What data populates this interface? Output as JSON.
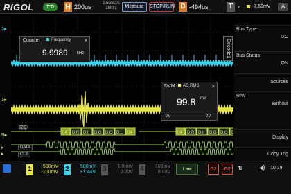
{
  "app": {
    "brand": "RIGOL",
    "mode": "T'D"
  },
  "topbar": {
    "h_label": "H",
    "timebase": "200us",
    "sample_rate": "2.5GSa/s",
    "mem_depth": "1Mpts",
    "measure": "Measure",
    "stop_run": "STOP/RUN",
    "d_label": "D",
    "delay": "-494us",
    "t_label": "T",
    "trigger_level": "-7.59mV",
    "trigger_source": "A"
  },
  "counter": {
    "title": "Counter",
    "tag": "Frequency",
    "value": "9.9989",
    "unit": "kHz"
  },
  "dvm": {
    "title": "DVM",
    "tag": "AC RMS",
    "value": "99.8",
    "unit": "mV",
    "scale_lo": "0V",
    "scale_hi": "2V"
  },
  "decode_tab": "Decode1",
  "menu": {
    "bus_type_label": "Bus Type",
    "bus_type_value": "I2C",
    "bus_status_label": "Bus Status",
    "bus_status_value": "ON",
    "sources": "Sources",
    "rw_label": "R/W",
    "rw_value": "Without",
    "display": "Display",
    "copy_trig": "Copy Trig"
  },
  "traces": {
    "bus_label": "I2C",
    "data_label": "DATA",
    "clk_label": "CLK",
    "i2c_left": [
      "04",
      "D:R",
      "D:I",
      "D:G",
      "D:O",
      "D:L",
      "04"
    ],
    "i2c_right": [
      "04",
      "D:R",
      "D:I",
      "D:G",
      "D:O",
      "D:L",
      "04"
    ]
  },
  "channels": [
    {
      "num": "1",
      "scale": "500mV",
      "offset": "-100mV",
      "color": "#e6e64a"
    },
    {
      "num": "2",
      "scale": "500mV",
      "offset": "+1.44V",
      "color": "#3ad0e8"
    },
    {
      "num": "3",
      "scale": "100mV",
      "offset": "0.00V",
      "color": "#777777"
    },
    {
      "num": "4",
      "scale": "100mV",
      "offset": "0.00V",
      "color": "#777777"
    }
  ],
  "status": {
    "la_label": "L",
    "g1": "G1",
    "g2": "G2",
    "time": "10:39",
    "volume_icon": "speaker-icon"
  }
}
